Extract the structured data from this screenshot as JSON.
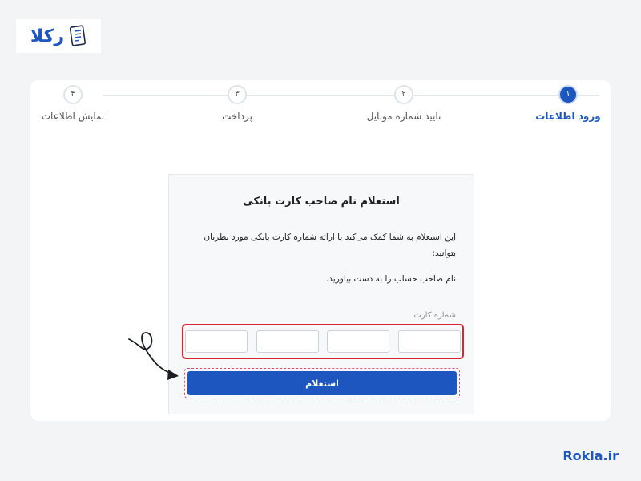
{
  "brand": {
    "logo_text": "رکلا",
    "footer": "Rokla.ir",
    "accent_color": "#1e56c0",
    "highlight_color": "#d7262f"
  },
  "steps": [
    {
      "number": "۱",
      "label": "ورود اطلاعات",
      "active": true
    },
    {
      "number": "۲",
      "label": "تایید شماره موبایل",
      "active": false
    },
    {
      "number": "۳",
      "label": "پرداخت",
      "active": false
    },
    {
      "number": "۴",
      "label": "نمایش اطلاعات",
      "active": false
    }
  ],
  "form": {
    "title": "استعلام نام صاحب کارت بانکی",
    "description": "این استعلام به شما کمک می‌کند با ارائه شماره کارت بانکی مورد نظرتان بتوانید:",
    "description2": "نام صاحب حساب را به دست بیاورید.",
    "card_label": "شماره کارت",
    "submit_label": "استعلام"
  },
  "icons": {
    "logo": "document-icon",
    "annotation": "curly-arrow-icon"
  }
}
